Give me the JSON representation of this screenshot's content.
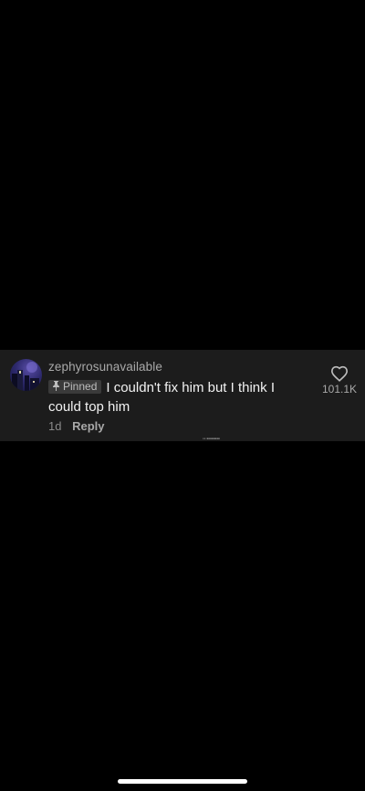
{
  "comment": {
    "username": "zephyrosunavailable",
    "pinned_label": "Pinned",
    "text": "I couldn't fix him but I think I could top him",
    "time": "1d",
    "reply_label": "Reply",
    "like_count": "101.1K",
    "avatar_icon": "avatar-image",
    "pin_icon": "pin-icon",
    "like_icon": "heart-outline-icon"
  },
  "colors": {
    "background": "#000000",
    "card": "#1c1c1c",
    "text_primary": "#f2f2f2",
    "text_secondary": "#a9a9a9"
  }
}
